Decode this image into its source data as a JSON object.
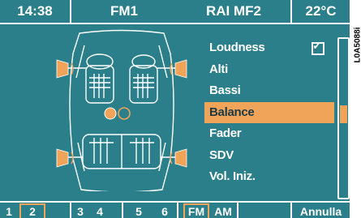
{
  "status": {
    "time": "14:38",
    "source": "FM1",
    "station": "RAI MF2",
    "temperature": "22°C"
  },
  "menu": {
    "items": [
      {
        "label": "Loudness",
        "checked": true
      },
      {
        "label": "Alti"
      },
      {
        "label": "Bassi"
      },
      {
        "label": "Balance",
        "selected": true
      },
      {
        "label": "Fader"
      },
      {
        "label": "SDV"
      },
      {
        "label": "Vol. Iniz."
      }
    ]
  },
  "bottom": {
    "presets": [
      "1",
      "2",
      "3",
      "4",
      "5",
      "6"
    ],
    "selected_preset": "2",
    "bands": [
      "FM",
      "AM"
    ],
    "selected_band": "FM",
    "cancel_label": "Annulla"
  },
  "side_code": "L0A5088i",
  "colors": {
    "background": "#2a7f8a",
    "accent": "#f0a45a",
    "text": "#ffffff"
  }
}
